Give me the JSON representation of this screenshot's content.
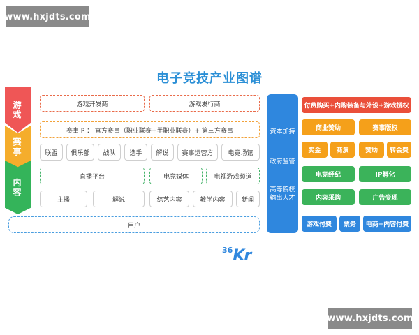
{
  "watermark": {
    "top": "www.hxjdts.com",
    "bottom": "www.hxjdts.com"
  },
  "title": "电子竞技产业图谱",
  "stages": [
    "游戏",
    "赛事",
    "内容"
  ],
  "left": {
    "row1": [
      "游戏开发商",
      "游戏发行商"
    ],
    "row2": "赛事IP ： 官方赛事（职业联赛+半职业联赛）+ 第三方赛事",
    "row3": [
      "联盟",
      "俱乐部",
      "战队",
      "选手",
      "解说",
      "赛事运营方",
      "电竞场馆"
    ],
    "row4": [
      "直播平台",
      "电竞媒体",
      "电视游戏频道"
    ],
    "row5": [
      "主播",
      "解说",
      "综艺内容",
      "教学内容",
      "新闻"
    ],
    "user": "用户"
  },
  "middle": [
    "资本加持",
    "政府监管",
    "高等院校\n输出人才"
  ],
  "right": {
    "r1": "付费购买+内购装备与外设+游戏授权",
    "r2": [
      "商业赞助",
      "赛事版权"
    ],
    "r3": [
      "奖金",
      "商演",
      "赞助",
      "转会费"
    ],
    "r4": [
      "电竞经纪",
      "IP孵化"
    ],
    "r5": [
      "内容采购",
      "广告变现"
    ],
    "r6": [
      "游戏付费",
      "票务",
      "电商+内容付费"
    ]
  },
  "logo": {
    "num": "36",
    "letters": "Kr"
  }
}
